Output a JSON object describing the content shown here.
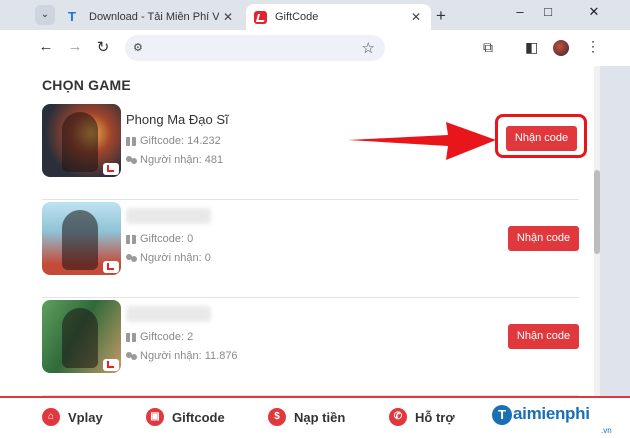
{
  "browser": {
    "tabs": [
      {
        "title": "Download - Tải Miễn Phí VN - S",
        "active": false
      },
      {
        "title": "GiftCode",
        "active": true
      }
    ],
    "window_controls": [
      "–",
      "□",
      "✕"
    ]
  },
  "page": {
    "section_title": "CHỌN GAME",
    "games": [
      {
        "name": "Phong Ma Đạo Sĩ",
        "giftcode_label": "Giftcode: 14.232",
        "receivers_label": "Người nhận: 481",
        "button": "Nhận code",
        "highlighted": true
      },
      {
        "name": "",
        "giftcode_label": "Giftcode: 0",
        "receivers_label": "Người nhận: 0",
        "button": "Nhận code",
        "highlighted": false
      },
      {
        "name": "",
        "giftcode_label": "Giftcode: 2",
        "receivers_label": "Người nhận: 11.876",
        "button": "Nhận code",
        "highlighted": false
      }
    ]
  },
  "bottom_nav": [
    {
      "label": "Vplay",
      "icon": "home-icon"
    },
    {
      "label": "Giftcode",
      "icon": "gift-icon"
    },
    {
      "label": "Nạp tiền",
      "icon": "dollar-icon"
    },
    {
      "label": "Hỗ trợ",
      "icon": "phone-icon"
    }
  ],
  "watermark": {
    "main": "aimienphi",
    "initial": "T",
    "sub": ".vn"
  },
  "colors": {
    "accent": "#e0383d",
    "highlight": "#e8151b",
    "watermark": "#1b6fb3"
  }
}
